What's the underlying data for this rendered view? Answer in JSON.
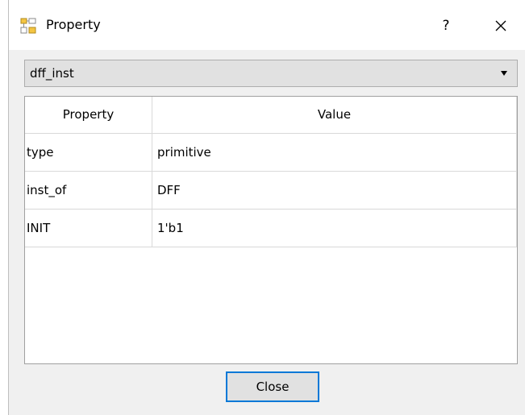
{
  "window": {
    "title": "Property",
    "help_label": "?",
    "accent": "#0078d7"
  },
  "selector": {
    "selected_value": "dff_inst"
  },
  "table": {
    "columns": [
      "Property",
      "Value"
    ],
    "rows": [
      {
        "property": "type",
        "value": "primitive"
      },
      {
        "property": "inst_of",
        "value": "DFF"
      },
      {
        "property": "INIT",
        "value": "1'b1"
      }
    ]
  },
  "footer": {
    "close_label": "Close"
  },
  "icons": {
    "app": "property-icon",
    "help": "help-icon",
    "close": "close-icon",
    "dropdown": "chevron-down-icon"
  }
}
